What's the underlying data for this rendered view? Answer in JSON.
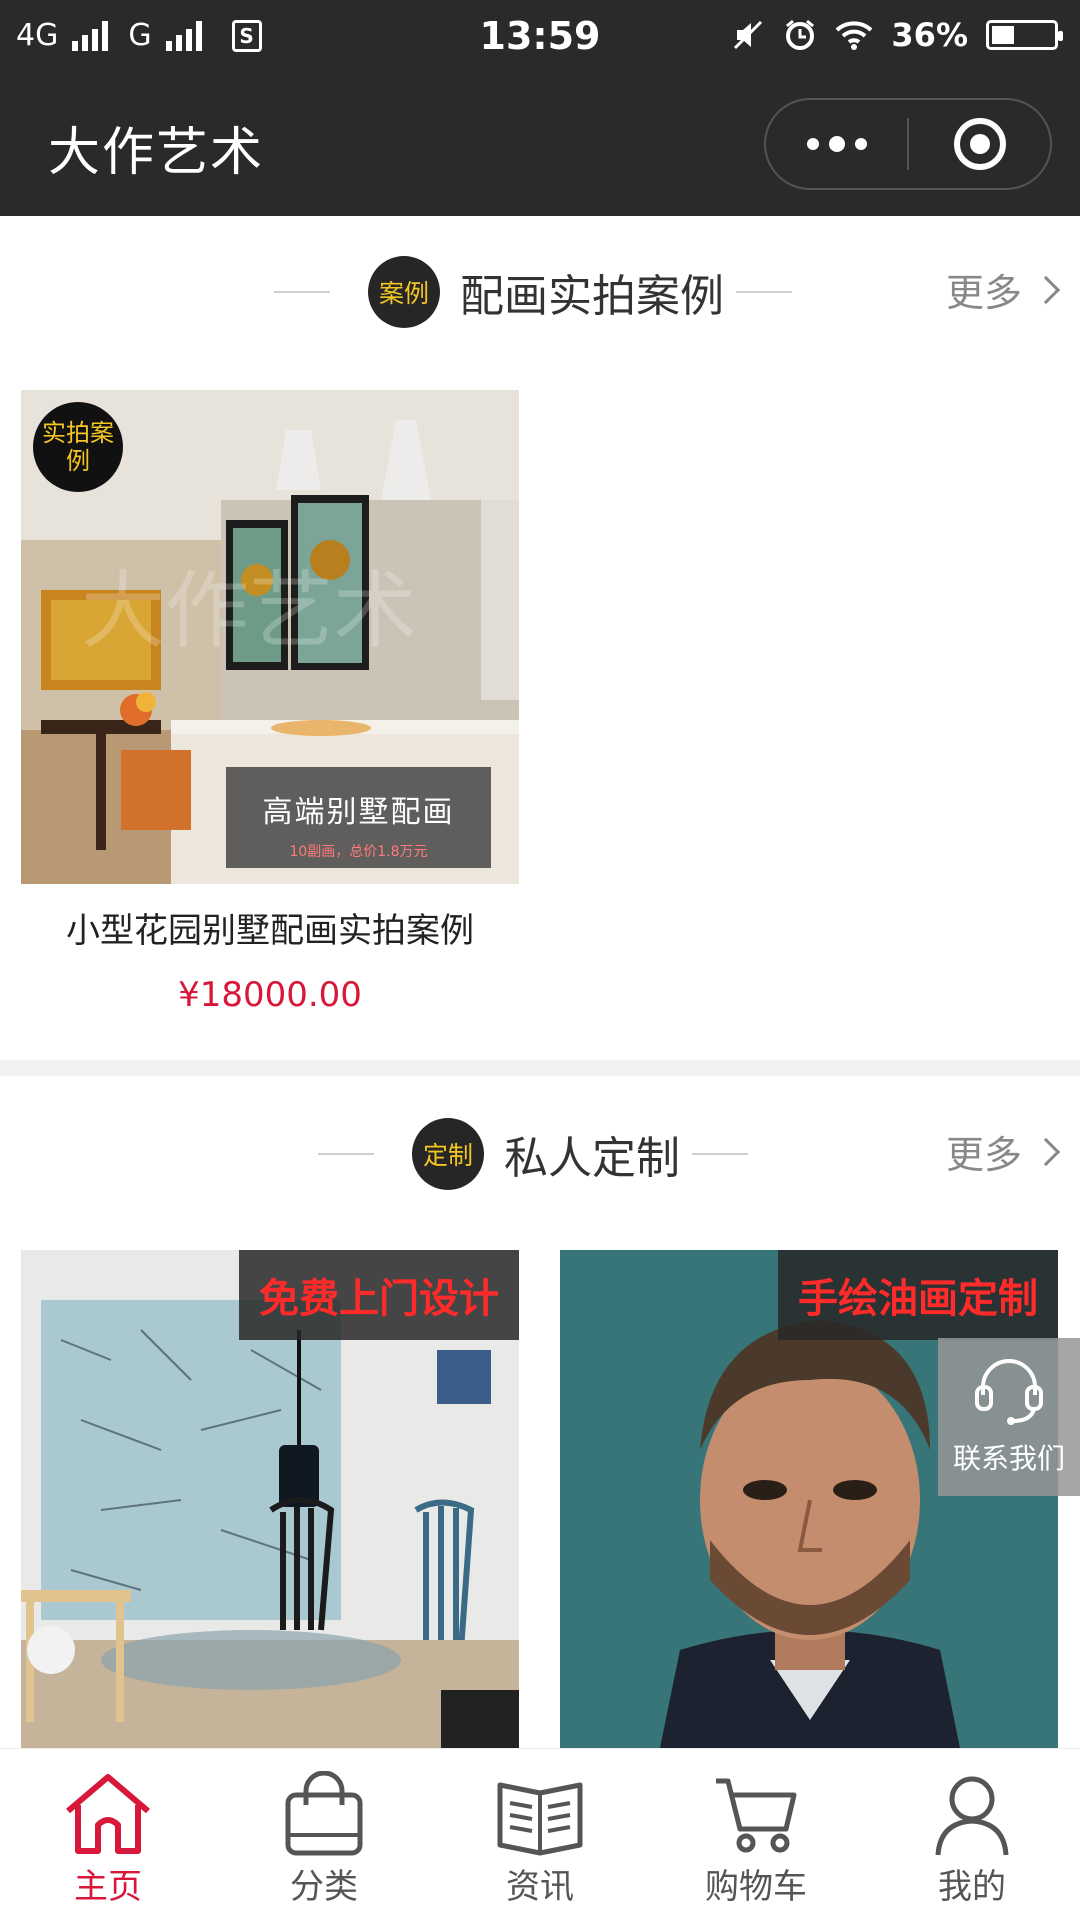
{
  "status_bar": {
    "network_left": "4G",
    "network_mid": "G",
    "sim_label": "S",
    "time": "13:59",
    "battery": "36%"
  },
  "nav": {
    "title": "大作艺术"
  },
  "section_cases": {
    "badge": "案例",
    "title": "配画实拍案例",
    "more": "更多"
  },
  "case_card": {
    "tag": "实拍案例",
    "overlay_title": "高端别墅配画",
    "overlay_sub": "10副画，总价1.8万元",
    "watermark": "大作艺术",
    "title": "小型花园别墅配画实拍案例",
    "price": "¥18000.00"
  },
  "section_custom": {
    "badge": "定制",
    "title": "私人定制",
    "more": "更多"
  },
  "custom_cards": [
    {
      "banner": "免费上门设计"
    },
    {
      "banner": "手绘油画定制"
    }
  ],
  "contact": {
    "label": "联系我们"
  },
  "tabbar": {
    "items": [
      {
        "label": "主页",
        "icon": "home-icon",
        "active": true
      },
      {
        "label": "分类",
        "icon": "bag-icon",
        "active": false
      },
      {
        "label": "资讯",
        "icon": "book-icon",
        "active": false
      },
      {
        "label": "购物车",
        "icon": "cart-icon",
        "active": false
      },
      {
        "label": "我的",
        "icon": "user-icon",
        "active": false
      }
    ]
  },
  "colors": {
    "accent": "#d8183a",
    "badge_text": "#f3c623",
    "topbar": "#2a2a2a"
  }
}
